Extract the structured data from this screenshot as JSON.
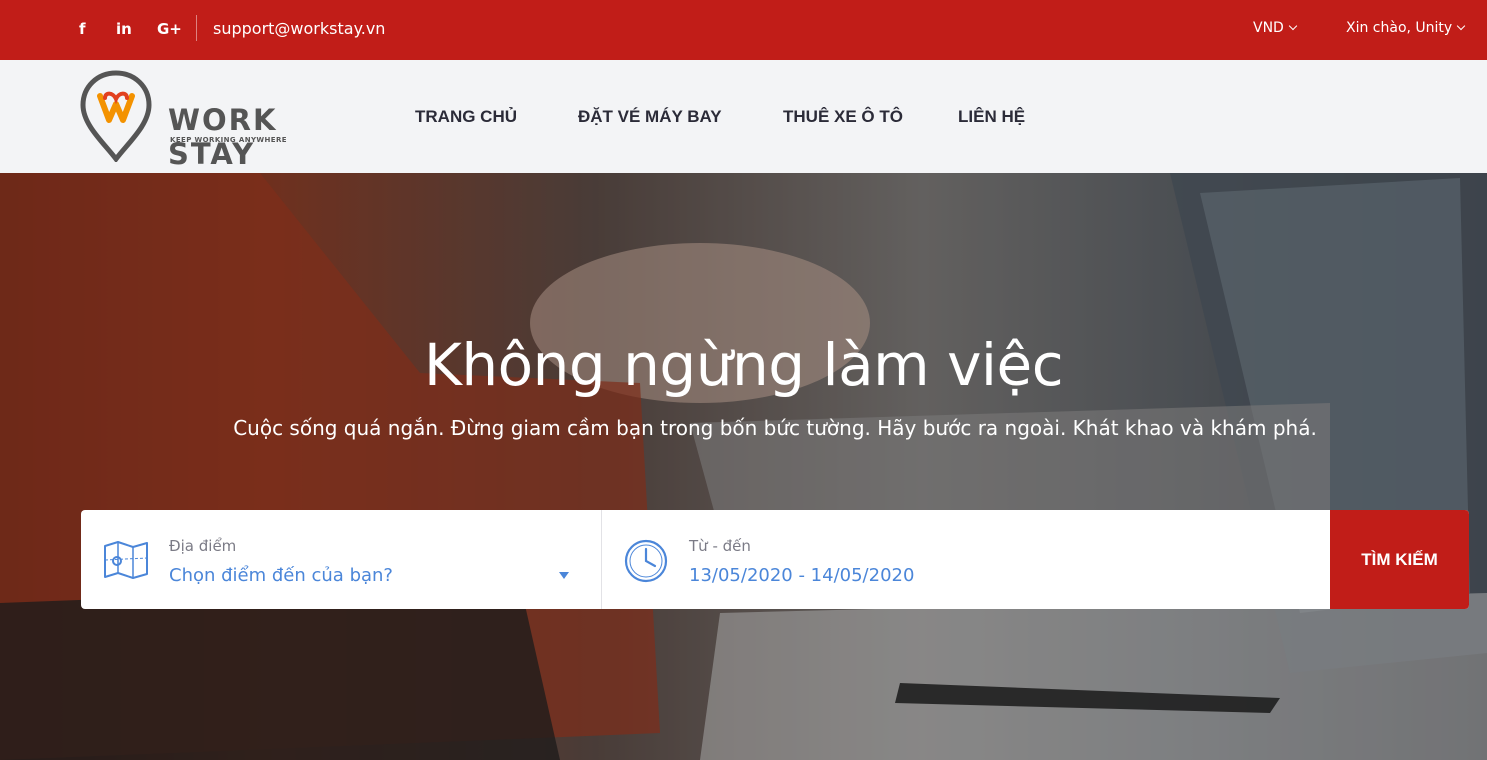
{
  "topbar": {
    "social": {
      "facebook": "f",
      "linkedin": "in",
      "googleplus": "G+"
    },
    "email": "support@workstay.vn",
    "currency": "VND",
    "greeting": "Xin chào, Unity"
  },
  "brand": {
    "name": "WORK STAY",
    "tagline": "KEEP WORKING ANYWHERE",
    "colors": {
      "primary": "#c11d18",
      "accent": "#f39200",
      "link": "#4b86d9"
    }
  },
  "nav": {
    "home": "TRANG CHỦ",
    "flight": "ĐẶT VÉ MÁY BAY",
    "car": "THUÊ XE Ô TÔ",
    "contact": "LIÊN HỆ"
  },
  "hero": {
    "title": "Không ngừng làm việc",
    "subtitle": "Cuộc sống quá ngắn. Đừng giam cầm bạn trong bốn bức tường. Hãy bước ra ngoài. Khát khao và khám phá."
  },
  "search": {
    "location_label": "Địa điểm",
    "location_value": "Chọn điểm đến của bạn?",
    "date_label": "Từ - đến",
    "date_value": "13/05/2020 - 14/05/2020",
    "button": "TÌM KIẾM"
  },
  "icons": {
    "facebook": "facebook-icon",
    "linkedin": "linkedin-icon",
    "googleplus": "google-plus-icon",
    "location": "map-icon",
    "date": "clock-icon",
    "dropdown": "caret-down-icon"
  }
}
